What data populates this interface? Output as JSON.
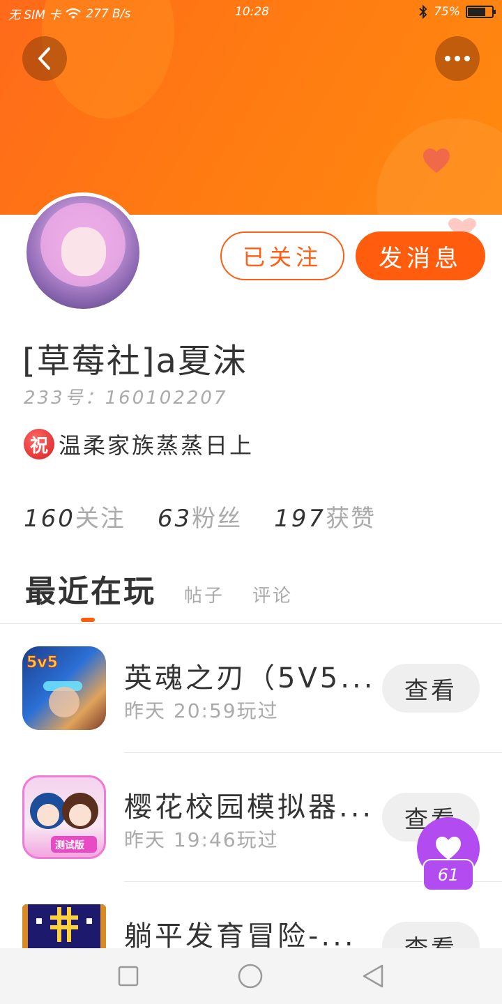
{
  "status_bar": {
    "carrier": "无 SIM 卡",
    "speed": "277 B/s",
    "time": "10:28",
    "battery_percent": "75%",
    "battery_level": 0.75
  },
  "header": {
    "back_icon": "back-arrow-icon",
    "more_icon": "more-dots-icon"
  },
  "actions": {
    "followed_label": "已关注",
    "message_label": "发消息"
  },
  "profile": {
    "username": "[草莓社]a夏沫",
    "user_id": "233号：160102207",
    "family_badge": "祝",
    "family_text": "温柔家族蒸蒸日上"
  },
  "stats": [
    {
      "num": "160",
      "label": "关注"
    },
    {
      "num": "63",
      "label": "粉丝"
    },
    {
      "num": "197",
      "label": "获赞"
    }
  ],
  "tabs": {
    "active": "最近在玩",
    "posts": "帖子",
    "comments": "评论"
  },
  "games": [
    {
      "title": "英魂之刃（5V5...",
      "time": "昨天 20:59玩过",
      "button": "查看"
    },
    {
      "title": "樱花校园模拟器...",
      "time": "昨天 19:46玩过",
      "button": "查看"
    },
    {
      "title": "躺平发育冒险-...",
      "time": "",
      "button": "查看"
    }
  ],
  "float_like": {
    "count": "61"
  },
  "colors": {
    "accent": "#ff5c0d",
    "banner": "#ff7a12",
    "like_purple": "#b24cf0"
  }
}
